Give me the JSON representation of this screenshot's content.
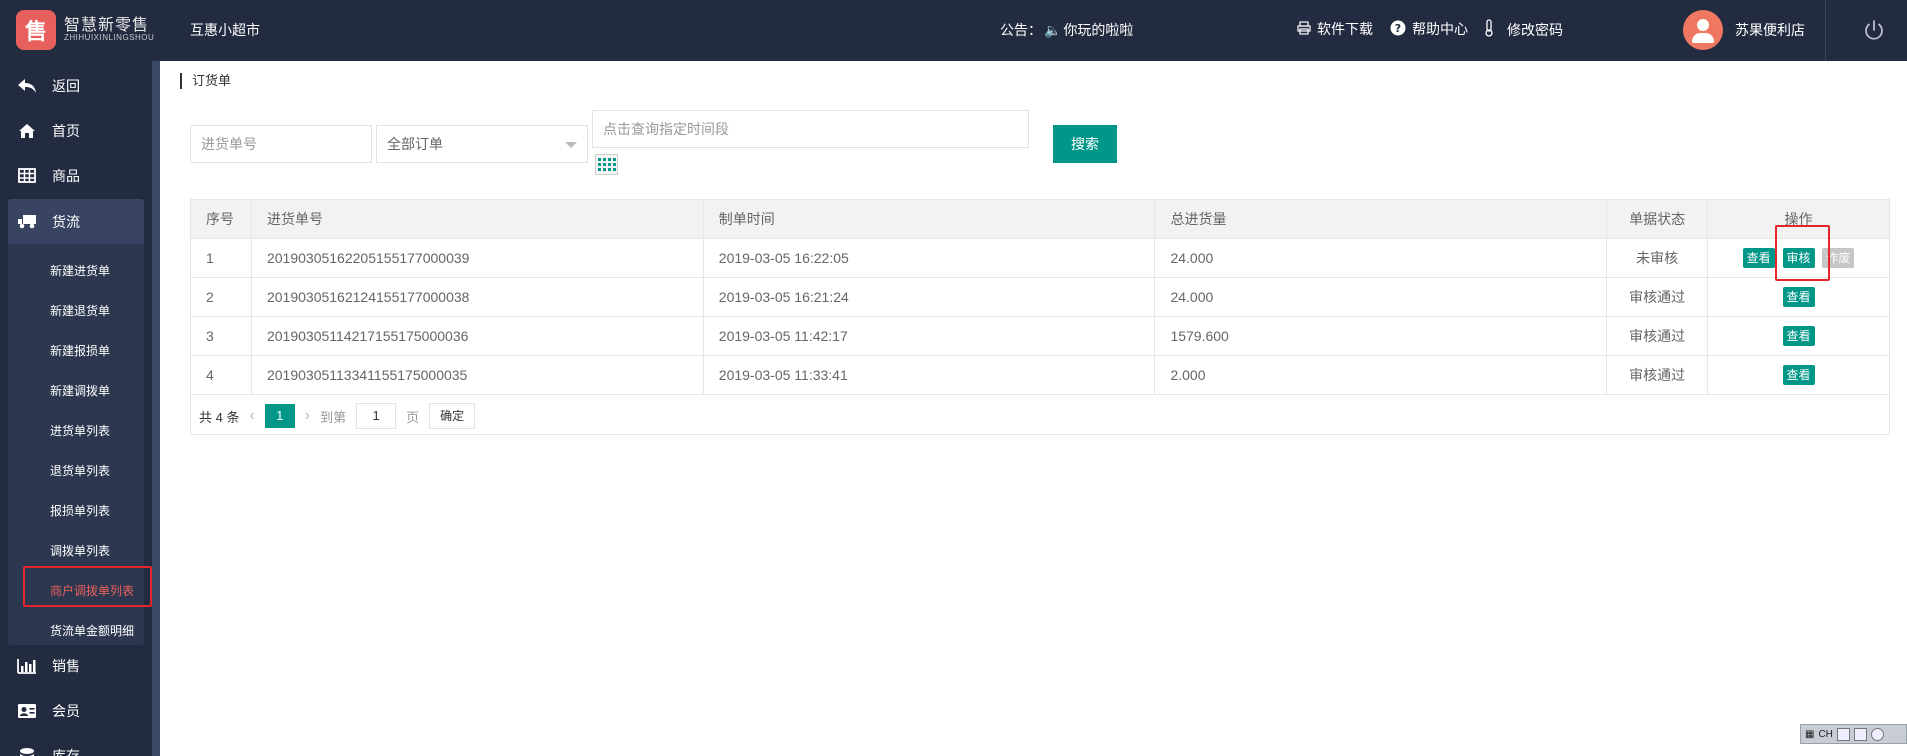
{
  "header": {
    "logo_glyph": "售",
    "logo_cn": "智慧新零售",
    "logo_en": "ZHIHUIXINLINGSHOU",
    "store_title": "互惠小超市",
    "notice_label": "公告：",
    "notice_text": "你玩的啦啦",
    "software_download": "软件下载",
    "help_center": "帮助中心",
    "change_password": "修改密码",
    "shop_name": "苏果便利店"
  },
  "sidebar": {
    "back": "返回",
    "home": "首页",
    "goods": "商品",
    "logistics": "货流",
    "sub_items": [
      "新建进货单",
      "新建退货单",
      "新建报损单",
      "新建调拨单",
      "进货单列表",
      "退货单列表",
      "报损单列表",
      "调拨单列表",
      "商户调拨单列表",
      "货流单金额明细"
    ],
    "sales": "销售",
    "members": "会员",
    "inventory": "库存"
  },
  "breadcrumb": "订货单",
  "filters": {
    "order_no_placeholder": "进货单号",
    "order_type_value": "全部订单",
    "time_placeholder": "点击查询指定时间段",
    "search_label": "搜索"
  },
  "table": {
    "headers": [
      "序号",
      "进货单号",
      "制单时间",
      "总进货量",
      "单据状态",
      "操作"
    ],
    "rows": [
      {
        "idx": "1",
        "order_no": "20190305162205155177000039",
        "time": "2019-03-05 16:22:05",
        "qty": "24.000",
        "status": "未审核"
      },
      {
        "idx": "2",
        "order_no": "20190305162124155177000038",
        "time": "2019-03-05 16:21:24",
        "qty": "24.000",
        "status": "审核通过"
      },
      {
        "idx": "3",
        "order_no": "20190305114217155175000036",
        "time": "2019-03-05 11:42:17",
        "qty": "1579.600",
        "status": "审核通过"
      },
      {
        "idx": "4",
        "order_no": "20190305113341155175000035",
        "time": "2019-03-05 11:33:41",
        "qty": "2.000",
        "status": "审核通过"
      }
    ],
    "op_view": "查看",
    "op_audit": "审核",
    "op_void": "作废"
  },
  "pager": {
    "total": "共 4 条",
    "current": "1",
    "goto_label": "到第",
    "goto_value": "1",
    "page_unit": "页",
    "confirm": "确定"
  },
  "tray": {
    "lang": "CH"
  },
  "colors": {
    "topbar": "#232b41",
    "accent": "#009688",
    "highlight": "#e4252b",
    "logo": "#e8605d"
  }
}
